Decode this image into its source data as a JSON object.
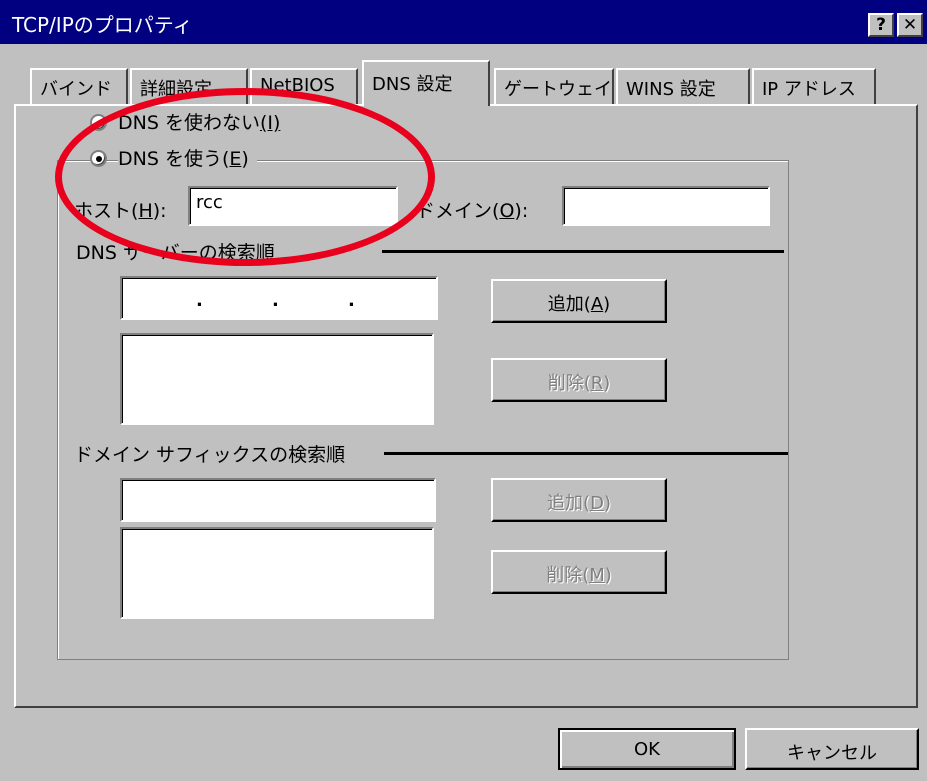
{
  "window": {
    "title": "TCP/IPのプロパティ",
    "help_glyph": "?",
    "close_glyph": "✕"
  },
  "tabs": [
    {
      "label": "バインド"
    },
    {
      "label": "詳細設定"
    },
    {
      "label": "NetBIOS"
    },
    {
      "label": "DNS 設定"
    },
    {
      "label": "ゲートウェイ"
    },
    {
      "label": "WINS 設定"
    },
    {
      "label": "IP アドレス"
    }
  ],
  "dns": {
    "disable_option": {
      "text": "DNS を使わない",
      "accel": "(I)"
    },
    "enable_option": {
      "text": "DNS を使う",
      "accel_key": "E"
    },
    "host": {
      "label_text": "ホスト",
      "accel_key": "H",
      "value": "rcc"
    },
    "domain": {
      "label_text": "ドメイン",
      "accel_key": "O",
      "value": ""
    },
    "server_order": {
      "title": "DNS サーバーの検索順",
      "ip_separators": [
        ".",
        " .",
        " ."
      ],
      "add_text": "追加",
      "add_key": "A",
      "remove_text": "削除",
      "remove_key": "R"
    },
    "suffix_order": {
      "title": "ドメイン サフィックスの検索順",
      "value": "",
      "add_text": "追加",
      "add_key": "D",
      "remove_text": "削除",
      "remove_key": "M"
    }
  },
  "footer": {
    "ok_label": "OK",
    "cancel_label": "キャンセル"
  },
  "colors": {
    "titlebar": "#000080",
    "face": "#c0c0c0",
    "annotation_ellipse": "#e8001c",
    "disabled_text": "#808080"
  }
}
